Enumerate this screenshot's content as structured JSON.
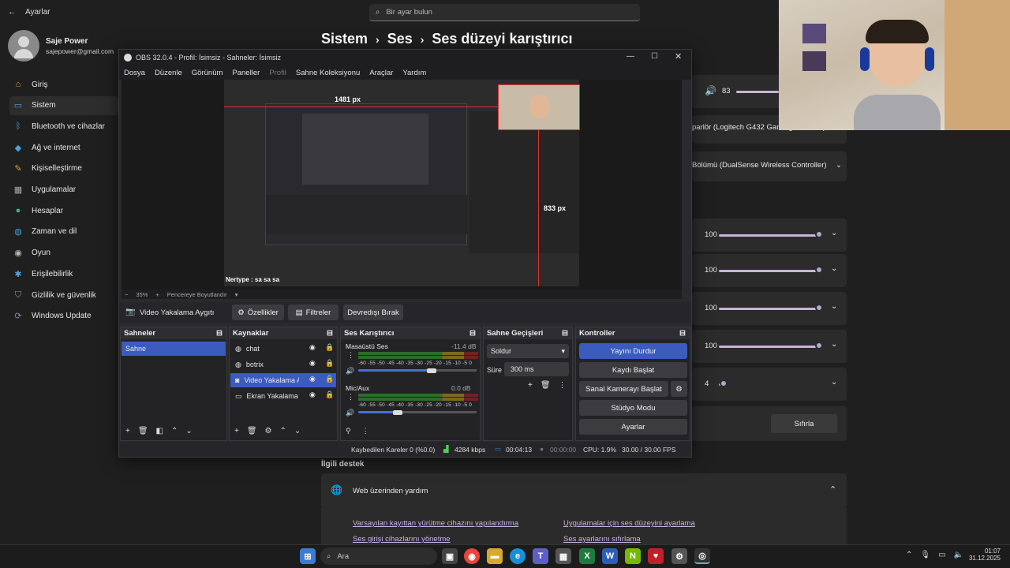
{
  "settings": {
    "back_label": "Ayarlar",
    "search_placeholder": "Bir ayar bulun",
    "user_name": "Saje Power",
    "user_email": "sajepower@gmail.com",
    "breadcrumb": [
      "Sistem",
      "Ses",
      "Ses düzeyi karıştırıcı"
    ],
    "sidebar": [
      {
        "label": "Giriş",
        "icon": "home-icon"
      },
      {
        "label": "Sistem",
        "icon": "system-icon"
      },
      {
        "label": "Bluetooth ve cihazlar",
        "icon": "bluetooth-icon"
      },
      {
        "label": "Ağ ve internet",
        "icon": "wifi-icon"
      },
      {
        "label": "Kişiselleştirme",
        "icon": "brush-icon"
      },
      {
        "label": "Uygulamalar",
        "icon": "apps-icon"
      },
      {
        "label": "Hesaplar",
        "icon": "account-icon"
      },
      {
        "label": "Zaman ve dil",
        "icon": "globe-icon"
      },
      {
        "label": "Oyun",
        "icon": "gamepad-icon"
      },
      {
        "label": "Erişilebilirlik",
        "icon": "accessibility-icon"
      },
      {
        "label": "Gizlilik ve güvenlik",
        "icon": "shield-icon"
      },
      {
        "label": "Windows Update",
        "icon": "update-icon"
      }
    ],
    "master_volume": "83",
    "output_device": "parlör (Logitech G432 Gaming Headset)",
    "input_device": "Bölümü (DualSense Wireless Controller)",
    "app_volumes": [
      "100",
      "100",
      "100",
      "100",
      "4"
    ],
    "reset_label": "Sıfırla",
    "related_support": "İlgili destek",
    "web_help": "Web üzerinden yardım",
    "links": [
      "Varsayılan kayıttan yürütme cihazını yapılandırma",
      "Uygulamalar için ses düzeyini ayarlama",
      "Ses girişi cihazlarını yönetme",
      "Ses ayarlarını sıfırlama"
    ]
  },
  "obs": {
    "title": "OBS 32.0.4 - Profil: İsimsiz - Sahneler: İsimsiz",
    "menu": [
      "Dosya",
      "Düzenle",
      "Görünüm",
      "Paneller",
      "Profil",
      "Sahne Koleksiyonu",
      "Araçlar",
      "Yardım"
    ],
    "preview_width": "1481 px",
    "preview_height": "833 px",
    "zoom": "35%",
    "zoom_mode": "Pencereye Boyutlandır",
    "selected_source": "Video Yakalama Aygıtı",
    "toolbar": {
      "properties": "Özellikler",
      "filters": "Filtreler",
      "deactivate": "Devredışı Bırak"
    },
    "scenes_title": "Sahneler",
    "scenes": [
      "Sahne"
    ],
    "sources_title": "Kaynaklar",
    "sources": [
      {
        "name": "chat",
        "icon": "browser-icon"
      },
      {
        "name": "botrix",
        "icon": "browser-icon"
      },
      {
        "name": "Video Yakalama Ay",
        "icon": "camera-icon"
      },
      {
        "name": "Ekran Yakalama",
        "icon": "monitor-icon"
      }
    ],
    "mixer_title": "Ses Karıştırıcı",
    "mixer": [
      {
        "name": "Masaüstü Ses",
        "db": "-11.4 dB",
        "level": 0.62
      },
      {
        "name": "Mic/Aux",
        "db": "0.0 dB",
        "level": 0.33
      }
    ],
    "meter_ticks": "-60 -55 -50 -45 -40 -35 -30 -25 -20 -15 -10 -5 0",
    "transitions_title": "Sahne Geçişleri",
    "transition": "Soldur",
    "duration_label": "Süre",
    "duration": "300 ms",
    "controls_title": "Kontroller",
    "controls": {
      "stream": "Yayını Durdur",
      "record": "Kaydı Başlat",
      "vcam": "Sanal Kamerayı Başlat",
      "studio": "Stüdyo Modu",
      "settings": "Ayarlar"
    },
    "status": {
      "dropped": "Kaybedilen Kareler 0 (%0.0)",
      "bitrate": "4284 kbps",
      "live_time": "00:04:13",
      "rec_time": "00:00:00",
      "cpu": "CPU: 1.9%",
      "fps": "30.00 / 30.00 FPS"
    }
  },
  "overlay_chat": "Nertype : sa sa sa",
  "taskbar": {
    "search": "Ara",
    "time": "01:07",
    "date": "31.12.2025"
  },
  "colors": {
    "accent": "#4a6fd1",
    "obs_bg": "#2a2a2e",
    "settings_bg": "#1f1f1f",
    "selection_red": "#d33"
  }
}
